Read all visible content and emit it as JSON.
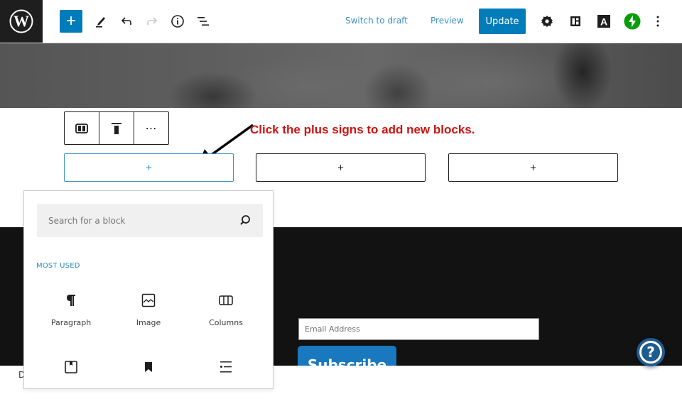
{
  "topbar": {
    "logo": "wordpress-logo",
    "add_block_label": "+",
    "switch_to_draft": "Switch to draft",
    "preview": "Preview",
    "update": "Update",
    "icons": [
      "plus-icon",
      "pencil-tools-icon",
      "undo-icon",
      "redo-icon",
      "info-icon",
      "list-view-icon",
      "settings-gear-icon",
      "layout-icon",
      "font-a-icon",
      "jetpack-bolt-icon",
      "more-vertical-icon"
    ],
    "colors": {
      "accent": "#007cba",
      "link": "#3a8fc4",
      "jetpack": "#069e08",
      "dark": "#1e1e1e"
    }
  },
  "block_toolbar": {
    "items": [
      {
        "name": "columns-block-type",
        "label": ""
      },
      {
        "name": "vertical-align-top",
        "label": ""
      },
      {
        "name": "more-options",
        "label": "⋯"
      }
    ]
  },
  "annotation": {
    "text": "Click the plus signs to add new blocks.",
    "color": "#cc1414"
  },
  "columns": [
    {
      "label": "+",
      "active": true
    },
    {
      "label": "+",
      "active": false
    },
    {
      "label": "+",
      "active": false
    }
  ],
  "inserter": {
    "search_placeholder": "Search for a block",
    "section_title": "MOST USED",
    "blocks": [
      {
        "label": "Paragraph",
        "icon": "paragraph-icon"
      },
      {
        "label": "Image",
        "icon": "image-icon"
      },
      {
        "label": "Columns",
        "icon": "columns-icon"
      },
      {
        "label": "",
        "icon": "reusable-bookmark-frame-icon"
      },
      {
        "label": "",
        "icon": "bookmark-icon"
      },
      {
        "label": "",
        "icon": "list-icon"
      }
    ]
  },
  "footer_section": {
    "email_placeholder": "Email Address",
    "subscribe_label": "Subscribe",
    "bottom_letter": "D",
    "help_label": "?"
  }
}
